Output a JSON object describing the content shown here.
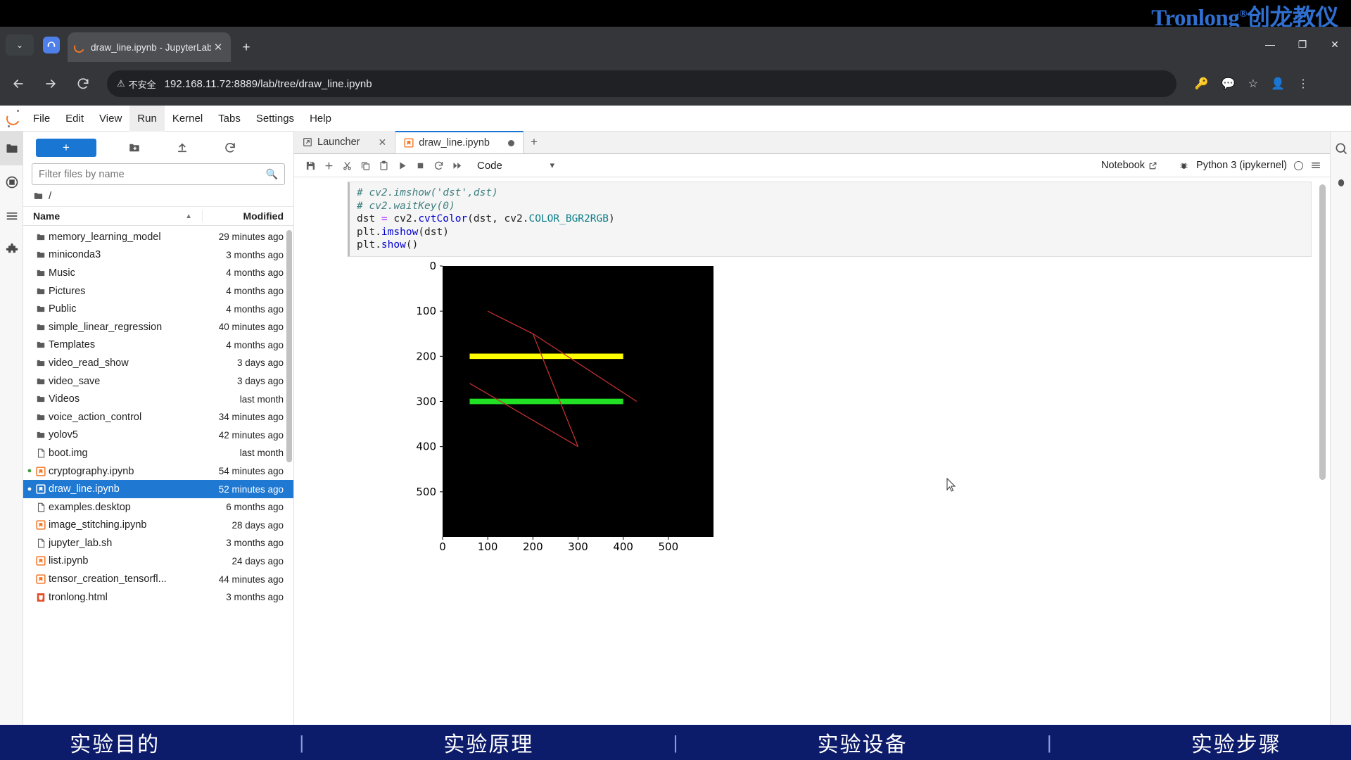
{
  "brand": {
    "name": "Tronlong",
    "reg": "®",
    "cn": "创龙教仪",
    "color": "#2f6fd0"
  },
  "browser": {
    "tab": {
      "title": "draw_line.ipynb - JupyterLab",
      "favicon": "jupyter-icon",
      "close": "✕"
    },
    "newtab_label": "+",
    "dropdown_label": "⌄",
    "window": {
      "minimize": "—",
      "maximize": "❐",
      "close": "✕"
    },
    "address": {
      "security_label": "不安全",
      "security_icon": "warning-triangle-icon",
      "url": "192.168.11.72:8889/lab/tree/draw_line.ipynb"
    },
    "omnibox_icons": [
      "password-key-icon",
      "translate-icon",
      "bookmark-star-icon"
    ],
    "profile_icon": "account-avatar-icon",
    "menu_icon": "three-dot-menu-icon"
  },
  "jupyter": {
    "menu": [
      "File",
      "Edit",
      "View",
      "Run",
      "Kernel",
      "Tabs",
      "Settings",
      "Help"
    ],
    "active_menu": "Run",
    "left_rail": [
      "folder-icon",
      "running-terminals-icon",
      "commands-icon",
      "extensions-icon"
    ],
    "right_rail": [
      "property-inspector-icon",
      "debugger-icon"
    ],
    "filebrowser": {
      "new_launcher_label": "+",
      "toolbar_icons": [
        "new-folder-icon",
        "upload-icon",
        "refresh-icon"
      ],
      "filter_placeholder": "Filter files by name",
      "filter_value": "",
      "breadcrumb": "/",
      "columns": {
        "name": "Name",
        "modified": "Modified"
      },
      "sort_direction": "ascending",
      "items": [
        {
          "name": "memory_learning_model",
          "modified": "29 minutes ago",
          "type": "folder",
          "dot": "",
          "selected": false
        },
        {
          "name": "miniconda3",
          "modified": "3 months ago",
          "type": "folder",
          "dot": "",
          "selected": false
        },
        {
          "name": "Music",
          "modified": "4 months ago",
          "type": "folder",
          "dot": "",
          "selected": false
        },
        {
          "name": "Pictures",
          "modified": "4 months ago",
          "type": "folder",
          "dot": "",
          "selected": false
        },
        {
          "name": "Public",
          "modified": "4 months ago",
          "type": "folder",
          "dot": "",
          "selected": false
        },
        {
          "name": "simple_linear_regression",
          "modified": "40 minutes ago",
          "type": "folder",
          "dot": "",
          "selected": false
        },
        {
          "name": "Templates",
          "modified": "4 months ago",
          "type": "folder",
          "dot": "",
          "selected": false
        },
        {
          "name": "video_read_show",
          "modified": "3 days ago",
          "type": "folder",
          "dot": "",
          "selected": false
        },
        {
          "name": "video_save",
          "modified": "3 days ago",
          "type": "folder",
          "dot": "",
          "selected": false
        },
        {
          "name": "Videos",
          "modified": "last month",
          "type": "folder",
          "dot": "",
          "selected": false
        },
        {
          "name": "voice_action_control",
          "modified": "34 minutes ago",
          "type": "folder",
          "dot": "",
          "selected": false
        },
        {
          "name": "yolov5",
          "modified": "42 minutes ago",
          "type": "folder",
          "dot": "",
          "selected": false
        },
        {
          "name": "boot.img",
          "modified": "last month",
          "type": "file",
          "dot": "",
          "selected": false
        },
        {
          "name": "cryptography.ipynb",
          "modified": "54 minutes ago",
          "type": "notebook",
          "dot": "running",
          "selected": false
        },
        {
          "name": "draw_line.ipynb",
          "modified": "52 minutes ago",
          "type": "notebook",
          "dot": "open",
          "selected": true
        },
        {
          "name": "examples.desktop",
          "modified": "6 months ago",
          "type": "file",
          "dot": "",
          "selected": false
        },
        {
          "name": "image_stitching.ipynb",
          "modified": "28 days ago",
          "type": "notebook",
          "dot": "",
          "selected": false
        },
        {
          "name": "jupyter_lab.sh",
          "modified": "3 months ago",
          "type": "file",
          "dot": "",
          "selected": false
        },
        {
          "name": "list.ipynb",
          "modified": "24 days ago",
          "type": "notebook",
          "dot": "",
          "selected": false
        },
        {
          "name": "tensor_creation_tensorfl...",
          "modified": "44 minutes ago",
          "type": "notebook",
          "dot": "",
          "selected": false
        },
        {
          "name": "tronlong.html",
          "modified": "3 months ago",
          "type": "html",
          "dot": "",
          "selected": false
        }
      ]
    },
    "dock_tabs": [
      {
        "label": "Launcher",
        "icon": "launcher-icon",
        "active": false,
        "dirty": false
      },
      {
        "label": "draw_line.ipynb",
        "icon": "notebook-icon",
        "active": true,
        "dirty": true
      }
    ],
    "dock_add_label": "+",
    "notebook_toolbar": {
      "icons": [
        "save-icon",
        "insert-cell-icon",
        "cut-icon",
        "copy-icon",
        "paste-icon",
        "run-icon",
        "stop-icon",
        "restart-icon",
        "restart-run-all-icon"
      ],
      "cell_type": "Code",
      "cell_type_caret": "⌄",
      "notebook_label": "Notebook",
      "notebook_external_icon": "external-link-icon",
      "debugger_icon": "bug-icon",
      "kernel_name": "Python 3 (ipykernel)",
      "kernel_status_icon": "kernel-idle-circle",
      "sidebar_icon": "hamburger-icon"
    },
    "cell": {
      "lines": [
        [
          {
            "t": "# cv2.imshow('dst',dst)",
            "c": "k-com"
          }
        ],
        [
          {
            "t": "# cv2.waitKey(0)",
            "c": "k-com"
          }
        ],
        [
          {
            "t": "dst ",
            "c": ""
          },
          {
            "t": "=",
            "c": "k-pur"
          },
          {
            "t": " cv2.",
            "c": ""
          },
          {
            "t": "cvtColor",
            "c": "k-blue"
          },
          {
            "t": "(dst, cv2.",
            "c": ""
          },
          {
            "t": "COLOR_BGR2RGB",
            "c": "k-teal"
          },
          {
            "t": ")",
            "c": ""
          }
        ],
        [
          {
            "t": "plt.",
            "c": ""
          },
          {
            "t": "imshow",
            "c": "k-blue"
          },
          {
            "t": "(dst)",
            "c": ""
          }
        ],
        [
          {
            "t": "plt.",
            "c": ""
          },
          {
            "t": "show",
            "c": "k-blue"
          },
          {
            "t": "()",
            "c": ""
          }
        ]
      ]
    }
  },
  "chart_data": {
    "type": "scatter",
    "title": "",
    "xlabel": "",
    "ylabel": "",
    "xticks": [
      0,
      100,
      200,
      300,
      400,
      500
    ],
    "yticks": [
      0,
      100,
      200,
      300,
      400,
      500
    ],
    "xlim": [
      0,
      600
    ],
    "ylim": [
      600,
      0
    ],
    "grid": false,
    "background": "#000000",
    "description": "matplotlib imshow of an OpenCV canvas with drawn lines",
    "shapes": [
      {
        "kind": "line",
        "name": "yellow-thick-line",
        "color": "#ffff00",
        "width": 12,
        "points": [
          [
            60,
            200
          ],
          [
            400,
            200
          ]
        ]
      },
      {
        "kind": "line",
        "name": "green-thick-line",
        "color": "#22e024",
        "width": 12,
        "points": [
          [
            60,
            300
          ],
          [
            400,
            300
          ]
        ]
      },
      {
        "kind": "line",
        "name": "red-line-1",
        "color": "#c23030",
        "width": 2,
        "points": [
          [
            100,
            100
          ],
          [
            200,
            150
          ]
        ]
      },
      {
        "kind": "line",
        "name": "red-line-2",
        "color": "#c23030",
        "width": 2,
        "points": [
          [
            200,
            150
          ],
          [
            300,
            400
          ]
        ]
      },
      {
        "kind": "line",
        "name": "red-line-3",
        "color": "#c23030",
        "width": 2,
        "points": [
          [
            300,
            400
          ],
          [
            60,
            260
          ]
        ]
      },
      {
        "kind": "line",
        "name": "red-line-4",
        "color": "#c23030",
        "width": 2,
        "points": [
          [
            200,
            150
          ],
          [
            430,
            300
          ]
        ]
      }
    ]
  },
  "bottom_nav": {
    "items": [
      "实验目的",
      "实验原理",
      "实验设备",
      "实验步骤"
    ],
    "separator": "|",
    "background": "#0d1b6b"
  }
}
